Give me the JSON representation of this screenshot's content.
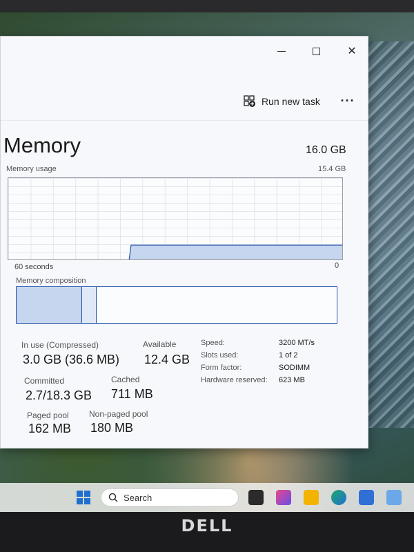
{
  "toolbar": {
    "run_new_task_label": "Run new task",
    "more_label": "···"
  },
  "memory": {
    "title": "Memory",
    "total": "16.0 GB",
    "usage_label": "Memory usage",
    "usage_max": "15.4 GB",
    "axis_left": "60 seconds",
    "axis_right": "0",
    "composition_label": "Memory composition",
    "usage_fraction": 0.19
  },
  "stats": {
    "in_use_label": "In use (Compressed)",
    "in_use_value": "3.0 GB (36.6 MB)",
    "available_label": "Available",
    "available_value": "12.4 GB",
    "committed_label": "Committed",
    "committed_value": "2.7/18.3 GB",
    "cached_label": "Cached",
    "cached_value": "711 MB",
    "paged_pool_label": "Paged pool",
    "paged_pool_value": "162 MB",
    "non_paged_pool_label": "Non-paged pool",
    "non_paged_pool_value": "180 MB"
  },
  "specs": {
    "speed_label": "Speed:",
    "speed_value": "3200 MT/s",
    "slots_label": "Slots used:",
    "slots_value": "1 of 2",
    "form_factor_label": "Form factor:",
    "form_factor_value": "SODIMM",
    "hw_reserved_label": "Hardware reserved:",
    "hw_reserved_value": "623 MB"
  },
  "taskbar": {
    "search_label": "Search"
  },
  "monitor": {
    "brand": "DELL"
  },
  "colors": {
    "accent": "#1f4fa8",
    "graph_fill": "#c5d6ee"
  }
}
